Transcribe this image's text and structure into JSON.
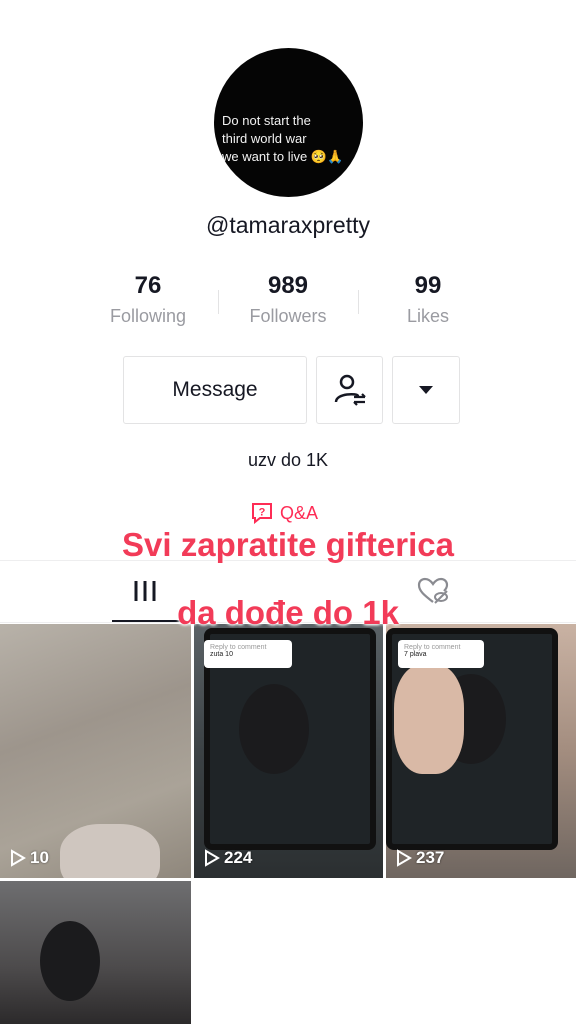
{
  "profile": {
    "avatar_text": "Do not start the\nthird world war\nwe want to live 🥺🙏",
    "username": "@tamaraxpretty",
    "bio": "uzv do 1K"
  },
  "stats": [
    {
      "value": "76",
      "label": "Following"
    },
    {
      "value": "989",
      "label": "Followers"
    },
    {
      "value": "99",
      "label": "Likes"
    }
  ],
  "actions": {
    "message_label": "Message",
    "follow_icon": "person-swap-icon",
    "more_icon": "caret-down-icon"
  },
  "qa": {
    "label": "Q&A",
    "icon": "qa-bubble-icon"
  },
  "overlay": {
    "line1": "Svi zapratite gifterica",
    "line2": "da dođe do 1k"
  },
  "tabs": [
    {
      "icon": "grid-icon",
      "active": true
    },
    {
      "icon": "liked-hidden-icon",
      "active": false
    }
  ],
  "videos": [
    {
      "views": "10"
    },
    {
      "views": "224",
      "comment_reply": "zuta 10"
    },
    {
      "views": "237",
      "comment_reply": "7 plava"
    },
    {
      "views": ""
    }
  ],
  "colors": {
    "accent": "#fe2c55",
    "overlay_text": "#f23b58"
  }
}
